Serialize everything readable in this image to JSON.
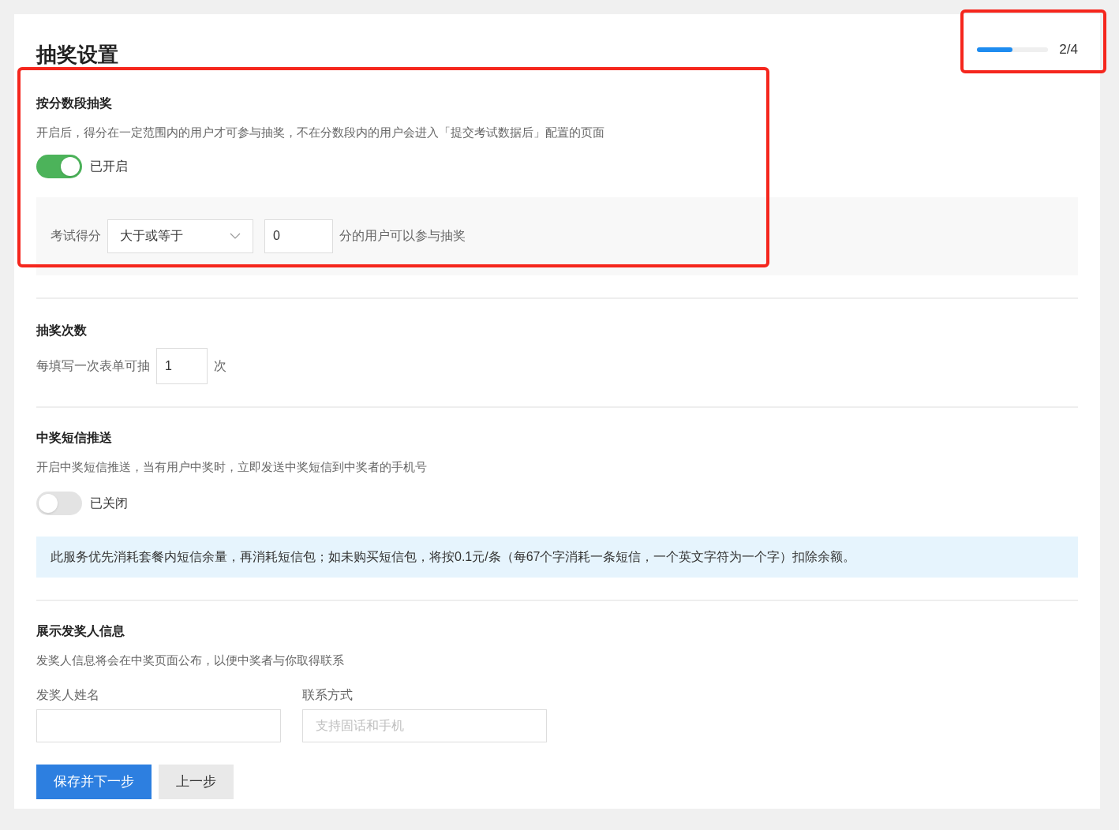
{
  "title": "抽奖设置",
  "progress": {
    "level": 0.5,
    "label": "2/4",
    "highlighted": true
  },
  "sections": [
    {
      "kind": "score_range",
      "title": "按分数段抽奖",
      "description": "开启后，得分在一定范围内的用户才可参与抽奖，不在分数段内的用户会进入「提交考试数据后」配置的页面",
      "highlighted": true,
      "toggle": {
        "on": true,
        "label": "已开启"
      },
      "rule": {
        "label": "考试得分",
        "select": "大于或等于",
        "value": "0",
        "suffix": "分的用户可以参与抽奖"
      }
    },
    {
      "kind": "draw_count",
      "title": "抽奖次数",
      "prefix": "每填写一次表单可抽",
      "value": "1",
      "suffix": "次"
    },
    {
      "kind": "sms",
      "title": "中奖短信推送",
      "description": "开启中奖短信推送，当有用户中奖时，立即发送中奖短信到中奖者的手机号",
      "toggle": {
        "on": false,
        "label": "已关闭"
      },
      "notice": "此服务优先消耗套餐内短信余量，再消耗短信包；如未购买短信包，将按0.1元/条（每67个字消耗一条短信，一个英文字符为一个字）扣除余额。"
    },
    {
      "kind": "contact",
      "title": "展示发奖人信息",
      "description": "发奖人信息将会在中奖页面公布，以便中奖者与你取得联系",
      "fields": [
        {
          "label": "发奖人姓名"
        },
        {
          "label": "联系方式",
          "placeholder": "支持固话和手机"
        }
      ]
    }
  ],
  "buttons": [
    {
      "label": "保存并下一步",
      "kind": "primary"
    },
    {
      "label": "上一步",
      "kind": "secondary"
    }
  ]
}
